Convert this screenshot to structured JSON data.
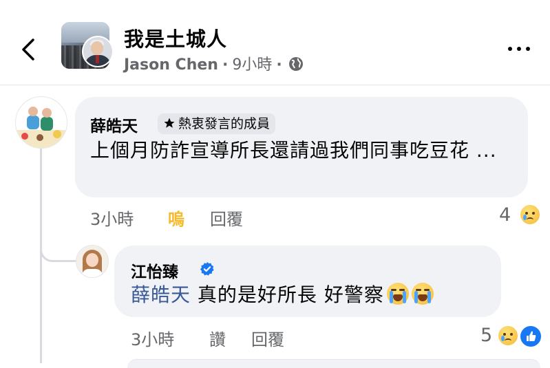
{
  "header": {
    "group_name": "我是土城人",
    "author_name": "Jason Chen",
    "separator": "·",
    "post_time": "9小時",
    "privacy_icon": "globe-icon",
    "back_icon": "chevron-left-icon",
    "more_icon": "more-horizontal-icon"
  },
  "comments": [
    {
      "author": "薛皓天",
      "badge": "熱衷發言的成員",
      "badge_icon": "star-icon",
      "text": "上個月防詐宣導所長還請過我們同事吃豆花 ...",
      "time": "3小時",
      "reaction_label": "嗚",
      "reply_label": "回覆",
      "reaction_count": "4",
      "reaction_icons": [
        "sad-emoji-icon"
      ]
    },
    {
      "author": "江怡臻",
      "verified_icon": "verified-badge-icon",
      "mention": "薛皓天",
      "text": "真的是好所長 好警察",
      "text_emojis": [
        "crying-emoji-icon",
        "crying-emoji-icon"
      ],
      "time": "3小時",
      "like_label": "讚",
      "reply_label": "回覆",
      "reaction_count": "5",
      "reaction_icons": [
        "sad-emoji-icon",
        "like-icon"
      ]
    }
  ],
  "colors": {
    "bubble": "#f0f2f5",
    "secondary_text": "#65676b",
    "reaction_yellow": "#f7b928",
    "mention_blue": "#385898",
    "like_blue": "#1877f2"
  }
}
